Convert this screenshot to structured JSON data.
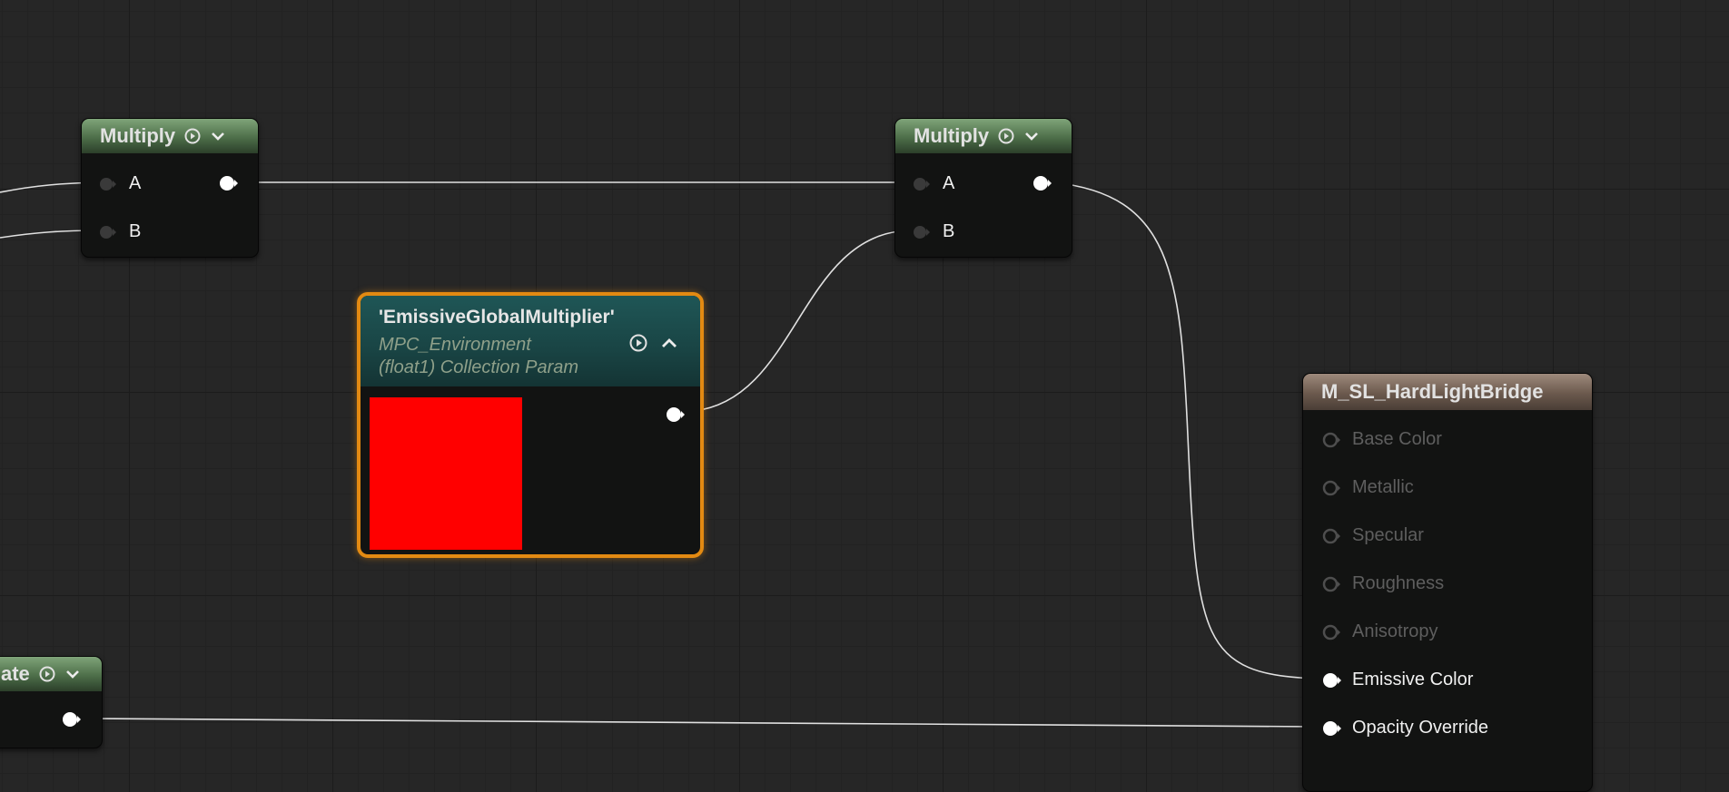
{
  "nodes": {
    "multiply_left": {
      "title": "Multiply",
      "inputs": [
        "A",
        "B"
      ]
    },
    "multiply_right": {
      "title": "Multiply",
      "inputs": [
        "A",
        "B"
      ]
    },
    "collection_param": {
      "title": "'EmissiveGlobalMultiplier'",
      "subtitle_line1": "MPC_Environment",
      "subtitle_line2": "(float1) Collection Param",
      "preview_color": "#ff0000"
    },
    "partial_node": {
      "title_fragment": "ate"
    },
    "material_output": {
      "title": "M_SL_HardLightBridge",
      "inputs": [
        {
          "label": "Base Color",
          "connected": false
        },
        {
          "label": "Metallic",
          "connected": false
        },
        {
          "label": "Specular",
          "connected": false
        },
        {
          "label": "Roughness",
          "connected": false
        },
        {
          "label": "Anisotropy",
          "connected": false
        },
        {
          "label": "Emissive Color",
          "connected": true
        },
        {
          "label": "Opacity Override",
          "connected": true
        }
      ]
    }
  },
  "colors": {
    "background": "#262626",
    "selection_outline": "#e38a12",
    "wire": "#e8e8e8"
  }
}
